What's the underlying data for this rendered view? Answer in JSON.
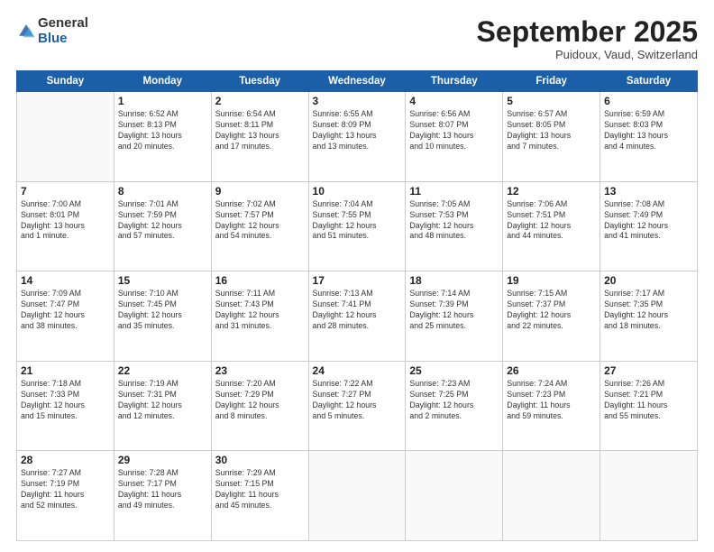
{
  "logo": {
    "general": "General",
    "blue": "Blue"
  },
  "header": {
    "month": "September 2025",
    "location": "Puidoux, Vaud, Switzerland"
  },
  "weekdays": [
    "Sunday",
    "Monday",
    "Tuesday",
    "Wednesday",
    "Thursday",
    "Friday",
    "Saturday"
  ],
  "weeks": [
    [
      {
        "day": "",
        "info": ""
      },
      {
        "day": "1",
        "info": "Sunrise: 6:52 AM\nSunset: 8:13 PM\nDaylight: 13 hours\nand 20 minutes."
      },
      {
        "day": "2",
        "info": "Sunrise: 6:54 AM\nSunset: 8:11 PM\nDaylight: 13 hours\nand 17 minutes."
      },
      {
        "day": "3",
        "info": "Sunrise: 6:55 AM\nSunset: 8:09 PM\nDaylight: 13 hours\nand 13 minutes."
      },
      {
        "day": "4",
        "info": "Sunrise: 6:56 AM\nSunset: 8:07 PM\nDaylight: 13 hours\nand 10 minutes."
      },
      {
        "day": "5",
        "info": "Sunrise: 6:57 AM\nSunset: 8:05 PM\nDaylight: 13 hours\nand 7 minutes."
      },
      {
        "day": "6",
        "info": "Sunrise: 6:59 AM\nSunset: 8:03 PM\nDaylight: 13 hours\nand 4 minutes."
      }
    ],
    [
      {
        "day": "7",
        "info": "Sunrise: 7:00 AM\nSunset: 8:01 PM\nDaylight: 13 hours\nand 1 minute."
      },
      {
        "day": "8",
        "info": "Sunrise: 7:01 AM\nSunset: 7:59 PM\nDaylight: 12 hours\nand 57 minutes."
      },
      {
        "day": "9",
        "info": "Sunrise: 7:02 AM\nSunset: 7:57 PM\nDaylight: 12 hours\nand 54 minutes."
      },
      {
        "day": "10",
        "info": "Sunrise: 7:04 AM\nSunset: 7:55 PM\nDaylight: 12 hours\nand 51 minutes."
      },
      {
        "day": "11",
        "info": "Sunrise: 7:05 AM\nSunset: 7:53 PM\nDaylight: 12 hours\nand 48 minutes."
      },
      {
        "day": "12",
        "info": "Sunrise: 7:06 AM\nSunset: 7:51 PM\nDaylight: 12 hours\nand 44 minutes."
      },
      {
        "day": "13",
        "info": "Sunrise: 7:08 AM\nSunset: 7:49 PM\nDaylight: 12 hours\nand 41 minutes."
      }
    ],
    [
      {
        "day": "14",
        "info": "Sunrise: 7:09 AM\nSunset: 7:47 PM\nDaylight: 12 hours\nand 38 minutes."
      },
      {
        "day": "15",
        "info": "Sunrise: 7:10 AM\nSunset: 7:45 PM\nDaylight: 12 hours\nand 35 minutes."
      },
      {
        "day": "16",
        "info": "Sunrise: 7:11 AM\nSunset: 7:43 PM\nDaylight: 12 hours\nand 31 minutes."
      },
      {
        "day": "17",
        "info": "Sunrise: 7:13 AM\nSunset: 7:41 PM\nDaylight: 12 hours\nand 28 minutes."
      },
      {
        "day": "18",
        "info": "Sunrise: 7:14 AM\nSunset: 7:39 PM\nDaylight: 12 hours\nand 25 minutes."
      },
      {
        "day": "19",
        "info": "Sunrise: 7:15 AM\nSunset: 7:37 PM\nDaylight: 12 hours\nand 22 minutes."
      },
      {
        "day": "20",
        "info": "Sunrise: 7:17 AM\nSunset: 7:35 PM\nDaylight: 12 hours\nand 18 minutes."
      }
    ],
    [
      {
        "day": "21",
        "info": "Sunrise: 7:18 AM\nSunset: 7:33 PM\nDaylight: 12 hours\nand 15 minutes."
      },
      {
        "day": "22",
        "info": "Sunrise: 7:19 AM\nSunset: 7:31 PM\nDaylight: 12 hours\nand 12 minutes."
      },
      {
        "day": "23",
        "info": "Sunrise: 7:20 AM\nSunset: 7:29 PM\nDaylight: 12 hours\nand 8 minutes."
      },
      {
        "day": "24",
        "info": "Sunrise: 7:22 AM\nSunset: 7:27 PM\nDaylight: 12 hours\nand 5 minutes."
      },
      {
        "day": "25",
        "info": "Sunrise: 7:23 AM\nSunset: 7:25 PM\nDaylight: 12 hours\nand 2 minutes."
      },
      {
        "day": "26",
        "info": "Sunrise: 7:24 AM\nSunset: 7:23 PM\nDaylight: 11 hours\nand 59 minutes."
      },
      {
        "day": "27",
        "info": "Sunrise: 7:26 AM\nSunset: 7:21 PM\nDaylight: 11 hours\nand 55 minutes."
      }
    ],
    [
      {
        "day": "28",
        "info": "Sunrise: 7:27 AM\nSunset: 7:19 PM\nDaylight: 11 hours\nand 52 minutes."
      },
      {
        "day": "29",
        "info": "Sunrise: 7:28 AM\nSunset: 7:17 PM\nDaylight: 11 hours\nand 49 minutes."
      },
      {
        "day": "30",
        "info": "Sunrise: 7:29 AM\nSunset: 7:15 PM\nDaylight: 11 hours\nand 45 minutes."
      },
      {
        "day": "",
        "info": ""
      },
      {
        "day": "",
        "info": ""
      },
      {
        "day": "",
        "info": ""
      },
      {
        "day": "",
        "info": ""
      }
    ]
  ]
}
